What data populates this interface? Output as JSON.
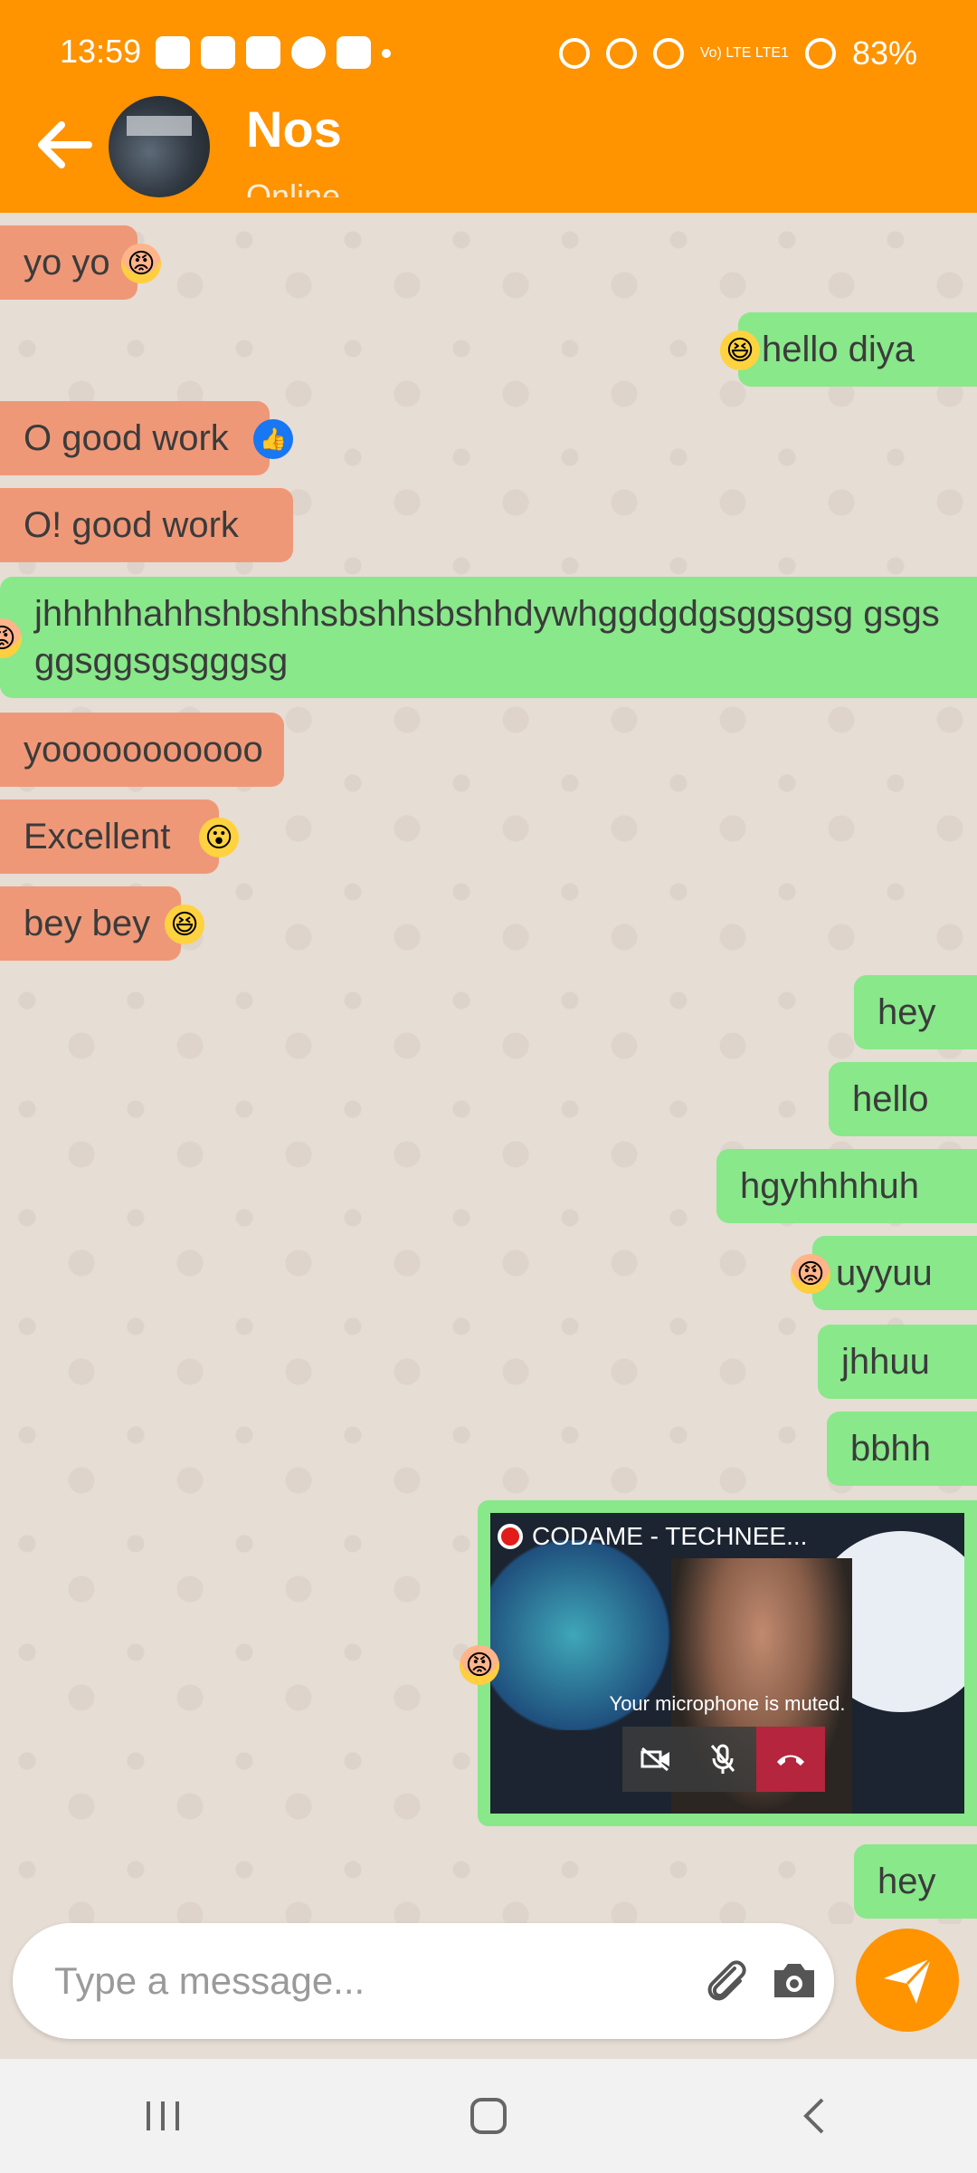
{
  "status_bar": {
    "time": "13:59",
    "battery": "83%",
    "network": "Vo) LTE LTE1",
    "left_icons": [
      "whatsapp-icon",
      "message-icon",
      "instagram-icon",
      "play-icon",
      "youtube-icon",
      "dot-icon"
    ],
    "right_icons": [
      "alarm-icon",
      "mute-icon",
      "hotspot-icon",
      "signal-icon",
      "battery-icon"
    ]
  },
  "header": {
    "contact_name": "Nos",
    "presence": "Online",
    "back_icon": "arrow-left-icon",
    "background_color": "#ff9300"
  },
  "messages": [
    {
      "side": "in",
      "text": "yo yo",
      "reaction": "😡"
    },
    {
      "side": "out",
      "text": "hello diya",
      "reaction": "😆"
    },
    {
      "side": "in",
      "text": "O good work",
      "reaction": "👍"
    },
    {
      "side": "in",
      "text": "O! good work",
      "reaction": ""
    },
    {
      "side": "out",
      "text": "jhhhhhahhshbshhsbshhsbshhdywhggdgdgsggsgsg gsgsggsggsgsgggsg",
      "reaction": "😡"
    },
    {
      "side": "in",
      "text": "yooooooooooo",
      "reaction": ""
    },
    {
      "side": "in",
      "text": "Excellent",
      "reaction": "😮"
    },
    {
      "side": "in",
      "text": "bey bey",
      "reaction": "😆"
    },
    {
      "side": "out",
      "text": "hey",
      "reaction": ""
    },
    {
      "side": "out",
      "text": "hello",
      "reaction": ""
    },
    {
      "side": "out",
      "text": "hgyhhhhuh",
      "reaction": ""
    },
    {
      "side": "out",
      "text": "uyyuu",
      "reaction": "😡"
    },
    {
      "side": "out",
      "text": "jhhuu",
      "reaction": ""
    },
    {
      "side": "out",
      "text": "bbhh",
      "reaction": ""
    },
    {
      "side": "out",
      "type": "video",
      "caption": "CODAME - TECHNEE...",
      "overlay": "Your microphone is muted.",
      "reaction": "😡"
    },
    {
      "side": "out",
      "text": "hey",
      "reaction": ""
    }
  ],
  "composer": {
    "placeholder": "Type a message...",
    "attach_icon": "paperclip-icon",
    "camera_icon": "camera-icon",
    "send_icon": "send-icon"
  },
  "colors": {
    "accent": "#ff9300",
    "incoming": "#ef9878",
    "outgoing": "#88e88a",
    "chat_bg": "#e6ddd4"
  },
  "nav": [
    "recent-apps-icon",
    "home-icon",
    "back-icon"
  ]
}
